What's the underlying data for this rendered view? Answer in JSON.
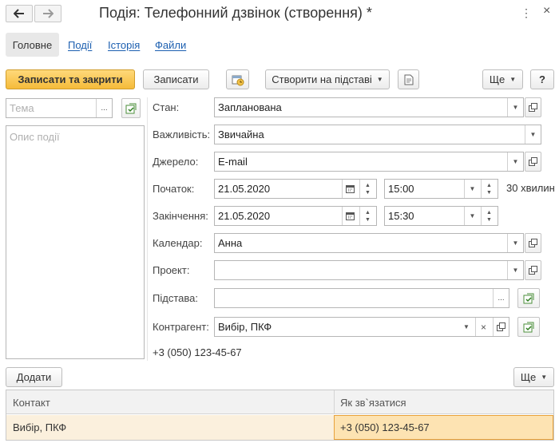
{
  "window": {
    "title": "Подія: Телефонний дзвінок (створення) *"
  },
  "tabs": [
    {
      "label": "Головне"
    },
    {
      "label": "Події"
    },
    {
      "label": "Історія"
    },
    {
      "label": "Файли"
    }
  ],
  "toolbar": {
    "save_close_label": "Записати та закрити",
    "save_label": "Записати",
    "create_based_label": "Створити на підставі",
    "more_label": "Ще",
    "help_label": "?"
  },
  "left": {
    "subject_placeholder": "Тема",
    "description_placeholder": "Опис події"
  },
  "form": {
    "state_label": "Стан:",
    "state_value": "Запланована",
    "importance_label": "Важливість:",
    "importance_value": "Звичайна",
    "source_label": "Джерело:",
    "source_value": "E-mail",
    "start_label": "Початок:",
    "start_date": "21.05.2020",
    "start_time": "15:00",
    "duration": "30 хвилин",
    "end_label": "Закінчення:",
    "end_date": "21.05.2020",
    "end_time": "15:30",
    "calendar_label": "Календар:",
    "calendar_value": "Анна",
    "project_label": "Проект:",
    "project_value": "",
    "basis_label": "Підстава:",
    "basis_value": "",
    "counterparty_label": "Контрагент:",
    "counterparty_value": "Вибір, ПКФ",
    "phone": "+3 (050) 123-45-67"
  },
  "contacts": {
    "add_label": "Додати",
    "more_label": "Ще",
    "columns": [
      "Контакт",
      "Як зв`язатися"
    ],
    "rows": [
      {
        "contact": "Вибір, ПКФ",
        "how": "+3 (050) 123-45-67"
      }
    ]
  },
  "icons": {
    "ellipsis": "...",
    "clear": "×",
    "more_vertical": "⋮"
  },
  "colors": {
    "primary_button": "#f5bb3a",
    "link": "#1c5fb0",
    "selected_row": "#fbf0dd",
    "selected_cell_border": "#e8a23a"
  }
}
